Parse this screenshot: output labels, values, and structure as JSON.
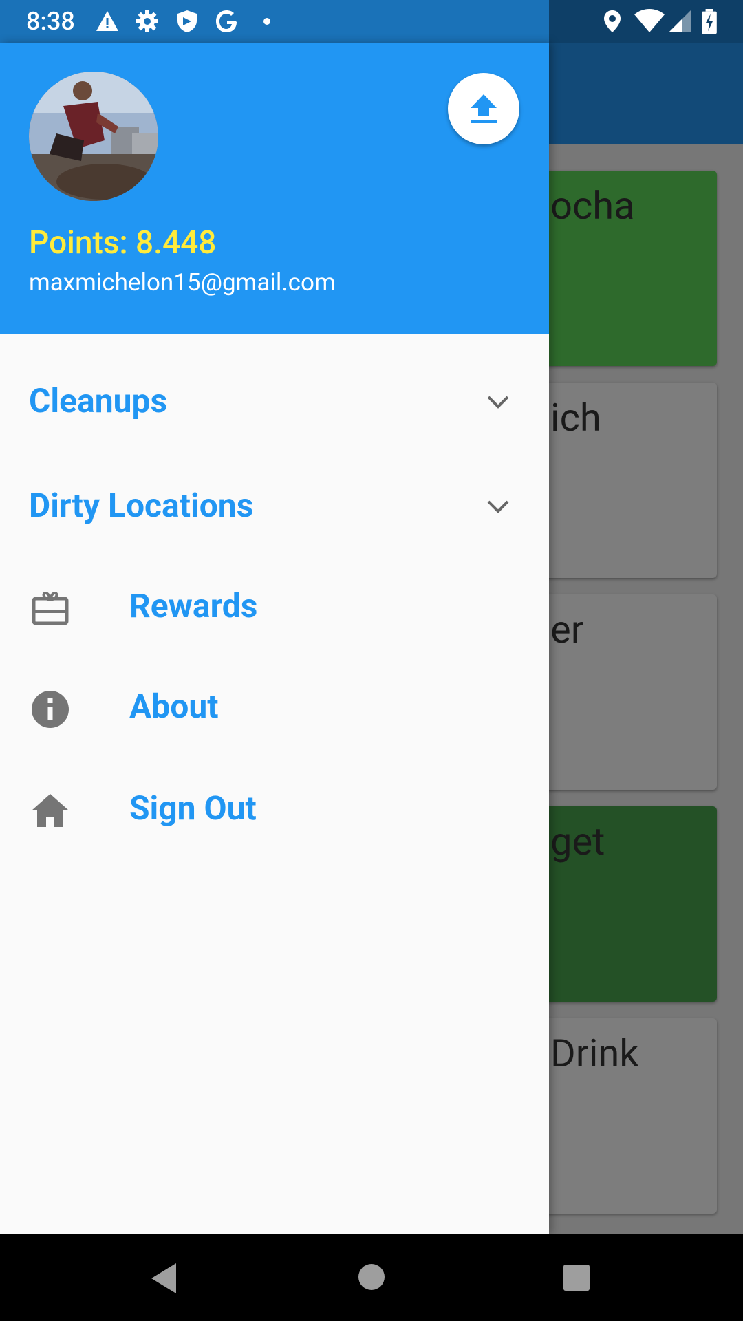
{
  "status_bar": {
    "time": "8:38",
    "left_icons": [
      "warning-icon",
      "gear-icon",
      "shield-icon",
      "google-icon",
      "dot-icon"
    ],
    "right_icons": [
      "location-icon",
      "wifi-icon",
      "signal-icon",
      "battery-charging-icon"
    ]
  },
  "drawer": {
    "header": {
      "points_label": "Points: 8.448",
      "email": "maxmichelon15@gmail.com",
      "upload_icon": "upload-icon"
    },
    "items": [
      {
        "label": "Cleanups",
        "expandable": true,
        "icon": "chevron-down-icon"
      },
      {
        "label": "Dirty Locations",
        "expandable": true,
        "icon": "chevron-down-icon"
      },
      {
        "label": "Rewards",
        "icon": "gift-card-icon"
      },
      {
        "label": "About",
        "icon": "info-icon"
      },
      {
        "label": "Sign Out",
        "icon": "home-icon"
      }
    ]
  },
  "background_cards": [
    {
      "text": "ocha",
      "color": "#2e6a2c"
    },
    {
      "text": "ich",
      "color": "#7d7d7d"
    },
    {
      "text": "er",
      "color": "#7d7d7d"
    },
    {
      "text": "get",
      "color": "#245126"
    },
    {
      "text": "Drink",
      "color": "#7d7d7d"
    }
  ],
  "colors": {
    "primary": "#2196f3",
    "points": "#ffeb3b",
    "status_bar": "#1a72b8"
  }
}
